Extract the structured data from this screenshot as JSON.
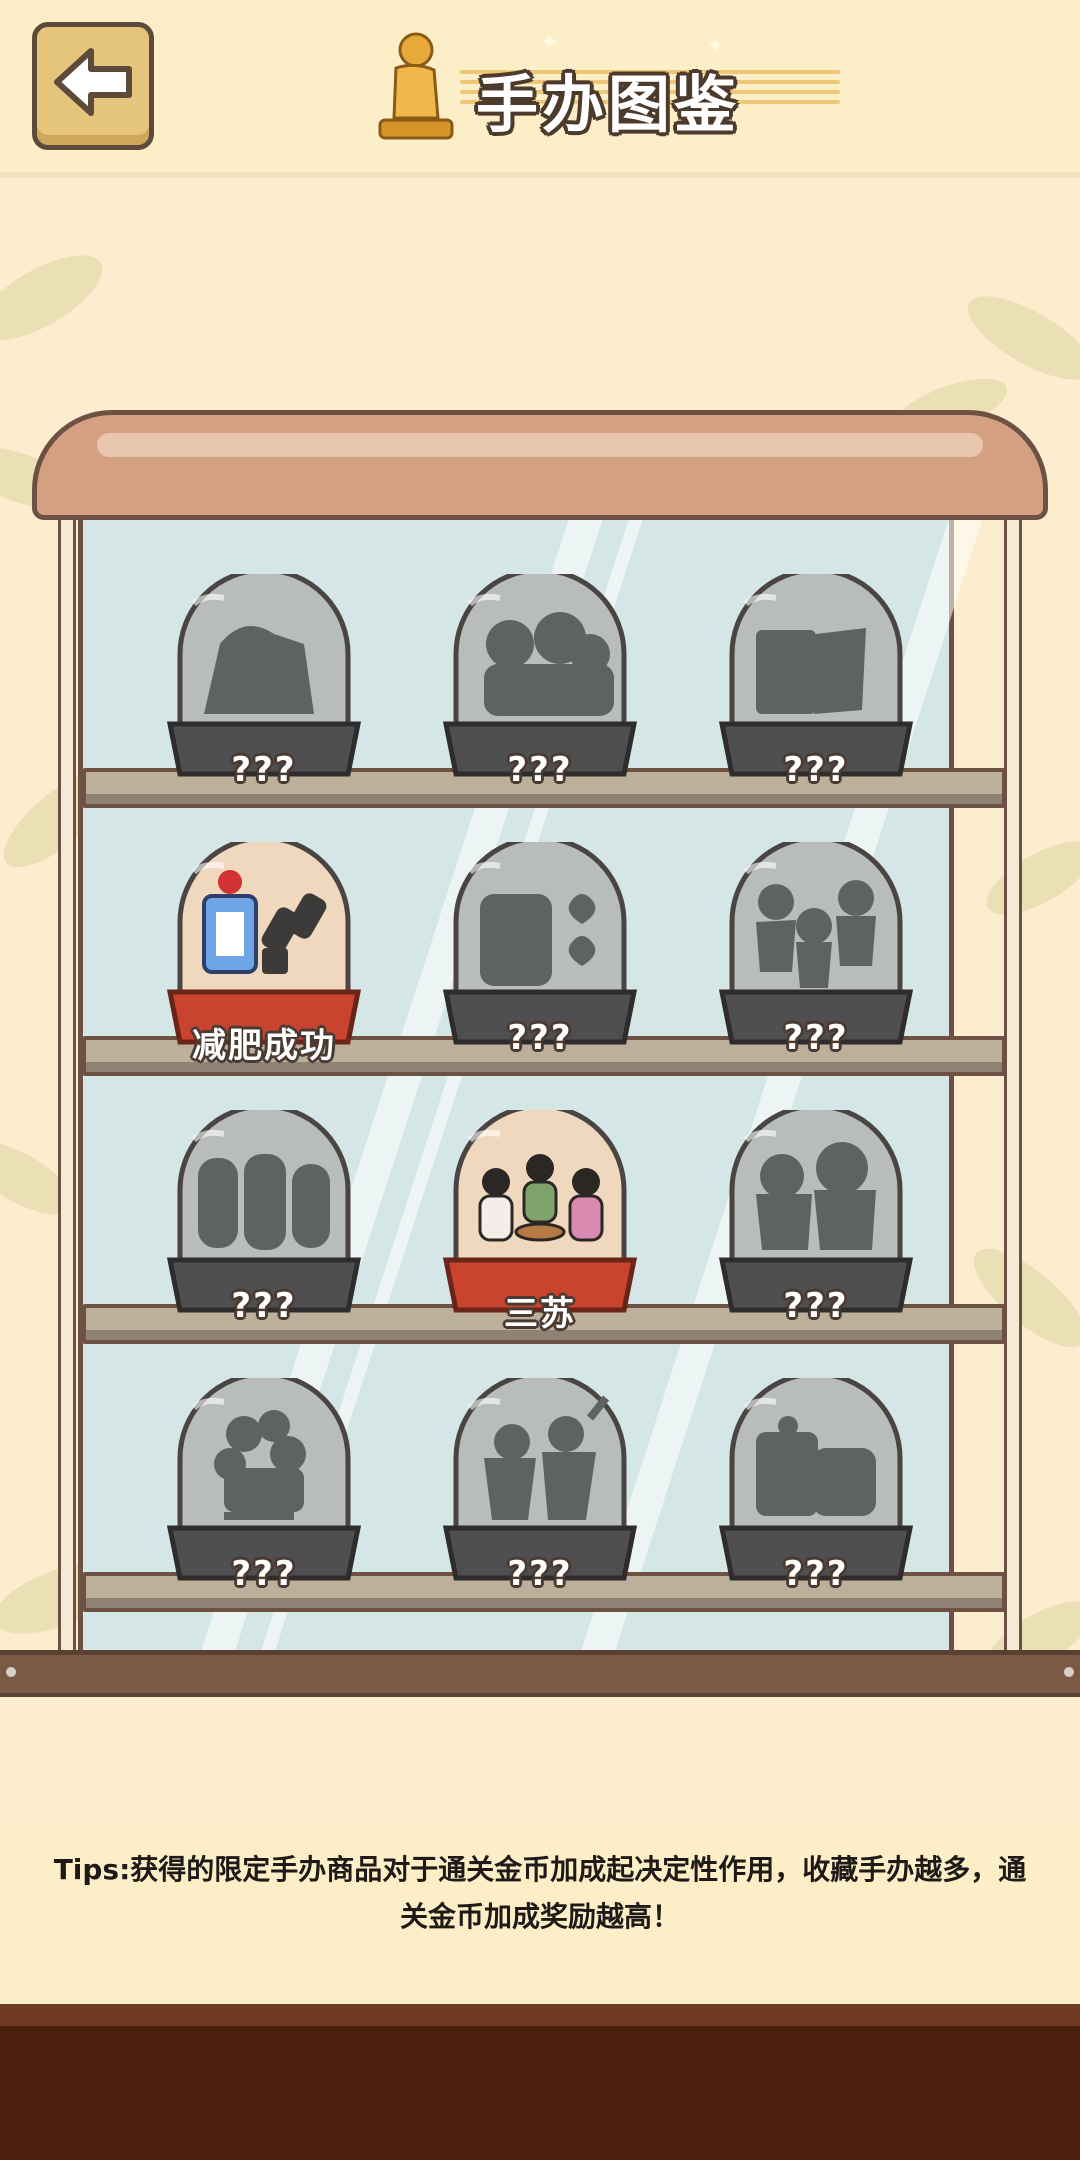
{
  "header": {
    "title": "手办图鉴",
    "back_icon": "left-arrow-icon",
    "title_icon": "golden-figurine-icon"
  },
  "collection": {
    "rows": [
      [
        {
          "label": "???",
          "unlocked": false,
          "silhouette": "warrior"
        },
        {
          "label": "???",
          "unlocked": false,
          "silhouette": "group"
        },
        {
          "label": "???",
          "unlocked": false,
          "silhouette": "banner"
        }
      ],
      [
        {
          "label": "减肥成功",
          "unlocked": true,
          "silhouette": "dumbbell"
        },
        {
          "label": "???",
          "unlocked": false,
          "silhouette": "hearts"
        },
        {
          "label": "???",
          "unlocked": false,
          "silhouette": "dancers"
        }
      ],
      [
        {
          "label": "???",
          "unlocked": false,
          "silhouette": "trio"
        },
        {
          "label": "三苏",
          "unlocked": true,
          "silhouette": "scholars"
        },
        {
          "label": "???",
          "unlocked": false,
          "silhouette": "pair"
        }
      ],
      [
        {
          "label": "???",
          "unlocked": false,
          "silhouette": "tree"
        },
        {
          "label": "???",
          "unlocked": false,
          "silhouette": "fighters"
        },
        {
          "label": "???",
          "unlocked": false,
          "silhouette": "chest"
        }
      ]
    ]
  },
  "tips": {
    "text": "Tips:获得的限定手办商品对于通关金币加成起决定性作用，收藏手办越多，通关金币加成奖励越高！"
  },
  "colors": {
    "background": "#fbedcd",
    "header": "#fcefc7",
    "cabinet_wood": "#d3a182",
    "glass": "#d5e6e6",
    "floor": "#4a1f0c"
  }
}
